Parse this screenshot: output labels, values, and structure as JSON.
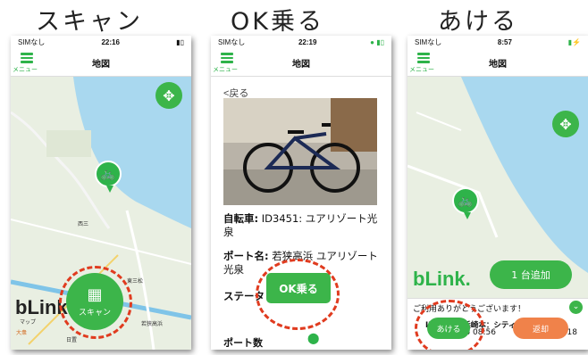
{
  "captions": [
    "スキャン",
    "OK乗る",
    "あける"
  ],
  "screen1": {
    "status": {
      "carrier": "SIMなし",
      "time": "22:16"
    },
    "title": "地図",
    "menu_label": "メニュー",
    "logo": "bLink.",
    "scan_label": "スキャン",
    "map_labels": [
      "東三松",
      "西三",
      "日置",
      "大衆",
      "マップ",
      "若狭高浜"
    ]
  },
  "screen2": {
    "status": {
      "carrier": "SIMなし",
      "time": "22:19"
    },
    "title": "地図",
    "menu_label": "メニュー",
    "back": "<戻る",
    "bike_label": "自転車:",
    "bike_value": "ID3451: ユアリゾート光泉",
    "port_label": "ポート名:",
    "port_value": "若狭高浜 ユアリゾート光泉",
    "status_label": "ステータ",
    "ok_button": "OK乗る",
    "count_label": "ポート数"
  },
  "screen3": {
    "status": {
      "carrier": "SIMなし",
      "time": "8:57"
    },
    "title": "地図",
    "menu_label": "メニュー",
    "logo": "bLink.",
    "add_button": "1 台追加",
    "thanks": "ご利用ありがとうございます！",
    "rental_id": "ID3003：浜崎本：シティーサイクル",
    "rental_date": "2023/9/26 08:56",
    "rental_elapsed": "00:00:18",
    "open_button": "あける",
    "return_button": "返却"
  },
  "colors": {
    "green": "#3cb54a",
    "orange": "#f0824a",
    "dash": "#e03b1f",
    "sea": "#a9d8ef",
    "land": "#e8eee0"
  }
}
